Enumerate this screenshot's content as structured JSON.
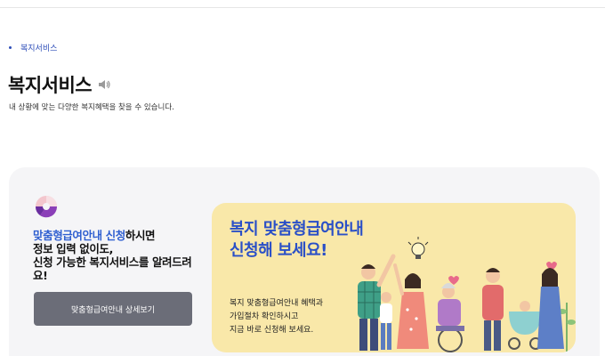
{
  "breadcrumb": {
    "current": "복지서비스"
  },
  "page": {
    "title": "복지서비스",
    "subtitle": "내 상황에 맞는 다양한 복지혜택을 찾을 수 있습니다."
  },
  "card": {
    "desc_highlight": "맞춤형급여안내 신청",
    "desc_rest_1": "하시면",
    "desc_line_2": "정보 입력 없이도,",
    "desc_line_3": "신청 가능한 복지서비스를 알려드려",
    "desc_line_4": "요!",
    "button_label": "맞춤형급여안내 상세보기"
  },
  "banner": {
    "title_line_1": "복지 맞춤형급여안내",
    "title_line_2": "신청해 보세요!",
    "text_line_1": "복지 맞춤형급여안내 혜택과",
    "text_line_2": "가입절차 확인하시고",
    "text_line_3": "지금 바로 신청해 보세요."
  },
  "icons": {
    "speaker": "speaker-icon",
    "pie": "pie-chart-icon"
  },
  "colors": {
    "accent": "#2f5fd0",
    "banner_bg": "#f9e8a9",
    "button_bg": "#6b6d78",
    "panel_bg": "#f5f5f7"
  }
}
